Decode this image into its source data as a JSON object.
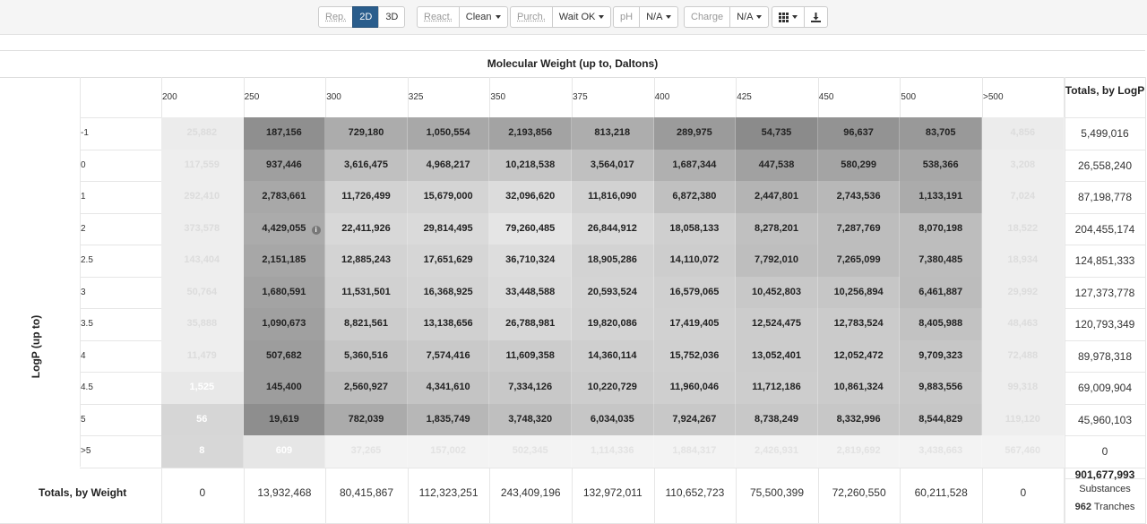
{
  "toolbar": {
    "rep": "Rep.",
    "two_d": "2D",
    "three_d": "3D",
    "react": "React.",
    "react_value": "Clean",
    "purch": "Purch.",
    "purch_value": "Wait OK",
    "ph": "pH",
    "ph_value": "N/A",
    "charge": "Charge",
    "charge_value": "N/A",
    "view_icon": "grid-icon",
    "download_icon": "download-icon"
  },
  "table": {
    "title": "Molecular Weight (up to, Daltons)",
    "y_axis_label": "LogP (up to)",
    "row_total_header": "Totals, by LogP",
    "col_total_label": "Totals, by Weight",
    "columns": [
      "200",
      "250",
      "300",
      "325",
      "350",
      "375",
      "400",
      "425",
      "450",
      "500",
      ">500"
    ],
    "rows": [
      "-1",
      "0",
      "1",
      "2",
      "2.5",
      "3",
      "3.5",
      "4",
      "4.5",
      "5",
      ">5"
    ],
    "cells": [
      [
        "25,882",
        "187,156",
        "729,180",
        "1,050,554",
        "2,193,856",
        "813,218",
        "289,975",
        "54,735",
        "96,637",
        "83,705",
        "4,856"
      ],
      [
        "117,559",
        "937,446",
        "3,616,475",
        "4,968,217",
        "10,218,538",
        "3,564,017",
        "1,687,344",
        "447,538",
        "580,299",
        "538,366",
        "3,208"
      ],
      [
        "292,410",
        "2,783,661",
        "11,726,499",
        "15,679,000",
        "32,096,620",
        "11,816,090",
        "6,872,380",
        "2,447,801",
        "2,743,536",
        "1,133,191",
        "7,024"
      ],
      [
        "373,578",
        "4,429,055",
        "22,411,926",
        "29,814,495",
        "79,260,485",
        "26,844,912",
        "18,058,133",
        "8,278,201",
        "7,287,769",
        "8,070,198",
        "18,522"
      ],
      [
        "143,404",
        "2,151,185",
        "12,885,243",
        "17,651,629",
        "36,710,324",
        "18,905,286",
        "14,110,072",
        "7,792,010",
        "7,265,099",
        "7,380,485",
        "18,934"
      ],
      [
        "50,764",
        "1,680,591",
        "11,531,501",
        "16,368,925",
        "33,448,588",
        "20,593,524",
        "16,579,065",
        "10,452,803",
        "10,256,894",
        "6,461,887",
        "29,992"
      ],
      [
        "35,888",
        "1,090,673",
        "8,821,561",
        "13,138,656",
        "26,788,981",
        "19,820,086",
        "17,419,405",
        "12,524,475",
        "12,783,524",
        "8,405,988",
        "48,463"
      ],
      [
        "11,479",
        "507,682",
        "5,360,516",
        "7,574,416",
        "11,609,358",
        "14,360,114",
        "15,752,036",
        "13,052,401",
        "12,052,472",
        "9,709,323",
        "72,488"
      ],
      [
        "1,525",
        "145,400",
        "2,560,927",
        "4,341,610",
        "7,334,126",
        "10,220,729",
        "11,960,046",
        "11,712,186",
        "10,861,324",
        "9,883,556",
        "99,318"
      ],
      [
        "56",
        "19,619",
        "782,039",
        "1,835,749",
        "3,748,320",
        "6,034,035",
        "7,924,267",
        "8,738,249",
        "8,332,996",
        "8,544,829",
        "119,120"
      ],
      [
        "8",
        "609",
        "37,265",
        "157,002",
        "502,345",
        "1,114,336",
        "1,884,317",
        "2,426,931",
        "2,819,692",
        "3,438,663",
        "567,460"
      ]
    ],
    "cell_shades": [
      [
        "#ececec",
        "#8f8f8f",
        "#acacac",
        "#a8a8a8",
        "#a3a3a3",
        "#adadad",
        "#9b9b9b",
        "#8b8b8b",
        "#939393",
        "#999999",
        "#ececec"
      ],
      [
        "#eeeeee",
        "#9f9f9f",
        "#c0c0c0",
        "#c3c3c3",
        "#c6c6c6",
        "#c0c0c0",
        "#b0b0b0",
        "#a1a1a1",
        "#a4a4a4",
        "#a7a7a7",
        "#eeeeee"
      ],
      [
        "#eeeeee",
        "#a8a8a8",
        "#d2d2d2",
        "#d4d4d4",
        "#dcdcdc",
        "#d2d2d2",
        "#c0c0c0",
        "#b4b4b4",
        "#b8b8b8",
        "#ababab",
        "#eeeeee"
      ],
      [
        "#eeeeee",
        "#ababab",
        "#d8d8d8",
        "#dadada",
        "#e5e5e5",
        "#d9d9d9",
        "#cfcfcf",
        "#c0c0c0",
        "#bdbdbd",
        "#bdbdbd",
        "#eeeeee"
      ],
      [
        "#eeeeee",
        "#a7a7a7",
        "#d3d3d3",
        "#d6d6d6",
        "#dddddd",
        "#d3d3d3",
        "#cdcdcd",
        "#bebebe",
        "#bdbdbd",
        "#bdbdbd",
        "#eeeeee"
      ],
      [
        "#eeeeee",
        "#a3a3a3",
        "#d1d1d1",
        "#d4d4d4",
        "#dbdbdb",
        "#d4d4d4",
        "#d0d0d0",
        "#c8c8c8",
        "#c6c6c6",
        "#bcbcbc",
        "#eeeeee"
      ],
      [
        "#eeeeee",
        "#a0a0a0",
        "#cccccc",
        "#d0d0d0",
        "#d7d7d7",
        "#d3d3d3",
        "#d1d1d1",
        "#cccccc",
        "#cbcbcb",
        "#c2c2c2",
        "#eeeeee"
      ],
      [
        "#eeeeee",
        "#9d9d9d",
        "#c5c5c5",
        "#c9c9c9",
        "#cccccc",
        "#cfcfcf",
        "#d0d0d0",
        "#cccccc",
        "#cbcbcb",
        "#c6c6c6",
        "#eeeeee"
      ],
      [
        "#e8e8e8",
        "#9d9d9d",
        "#bdbdbd",
        "#c4c4c4",
        "#c8c8c8",
        "#cdcdcd",
        "#cfcfcf",
        "#cdcdcd",
        "#cbcbcb",
        "#c8c8c8",
        "#eeeeee"
      ],
      [
        "#d6d6d6",
        "#8e8e8e",
        "#ababab",
        "#b7b7b7",
        "#bfbfbf",
        "#c6c6c6",
        "#c8c8c8",
        "#c8c8c8",
        "#c7c7c7",
        "#c6c6c6",
        "#eeeeee"
      ],
      [
        "#d7d7d7",
        "#e6e6e6",
        "#f3f3f3",
        "#f3f3f3",
        "#f3f3f3",
        "#f3f3f3",
        "#f3f3f3",
        "#f3f3f3",
        "#f3f3f3",
        "#f3f3f3",
        "#f3f3f3"
      ]
    ],
    "cell_text_colors": [
      [
        "#dcdcdc",
        "#222",
        "#222",
        "#222",
        "#222",
        "#222",
        "#222",
        "#222",
        "#222",
        "#222",
        "#dcdcdc"
      ],
      [
        "#dcdcdc",
        "#222",
        "#222",
        "#222",
        "#222",
        "#222",
        "#222",
        "#222",
        "#222",
        "#222",
        "#dcdcdc"
      ],
      [
        "#dcdcdc",
        "#222",
        "#222",
        "#222",
        "#222",
        "#222",
        "#222",
        "#222",
        "#222",
        "#222",
        "#dcdcdc"
      ],
      [
        "#dcdcdc",
        "#222",
        "#222",
        "#222",
        "#222",
        "#222",
        "#222",
        "#222",
        "#222",
        "#222",
        "#dcdcdc"
      ],
      [
        "#dcdcdc",
        "#222",
        "#222",
        "#222",
        "#222",
        "#222",
        "#222",
        "#222",
        "#222",
        "#222",
        "#dcdcdc"
      ],
      [
        "#dcdcdc",
        "#222",
        "#222",
        "#222",
        "#222",
        "#222",
        "#222",
        "#222",
        "#222",
        "#222",
        "#dcdcdc"
      ],
      [
        "#dcdcdc",
        "#222",
        "#222",
        "#222",
        "#222",
        "#222",
        "#222",
        "#222",
        "#222",
        "#222",
        "#dcdcdc"
      ],
      [
        "#dcdcdc",
        "#222",
        "#222",
        "#222",
        "#222",
        "#222",
        "#222",
        "#222",
        "#222",
        "#222",
        "#dcdcdc"
      ],
      [
        "#ffffff",
        "#222",
        "#222",
        "#222",
        "#222",
        "#222",
        "#222",
        "#222",
        "#222",
        "#222",
        "#dcdcdc"
      ],
      [
        "#ffffff",
        "#222",
        "#222",
        "#222",
        "#222",
        "#222",
        "#222",
        "#222",
        "#222",
        "#222",
        "#dcdcdc"
      ],
      [
        "#ffffff",
        "#ffffff",
        "#e2e2e2",
        "#e2e2e2",
        "#e2e2e2",
        "#e2e2e2",
        "#e2e2e2",
        "#e2e2e2",
        "#e2e2e2",
        "#e2e2e2",
        "#e2e2e2"
      ]
    ],
    "row_totals": [
      "5,499,016",
      "26,558,240",
      "87,198,778",
      "204,455,174",
      "124,851,333",
      "127,373,778",
      "120,793,349",
      "89,978,318",
      "69,009,904",
      "45,960,103",
      "0"
    ],
    "col_totals": [
      "0",
      "13,932,468",
      "80,415,867",
      "112,323,251",
      "243,409,196",
      "132,972,011",
      "110,652,723",
      "75,500,399",
      "72,260,550",
      "60,211,528",
      "0"
    ],
    "grand_total": "901,677,993",
    "grand_total_unit": "Substances",
    "tranches_count": "962",
    "tranches_label": "Tranches"
  }
}
